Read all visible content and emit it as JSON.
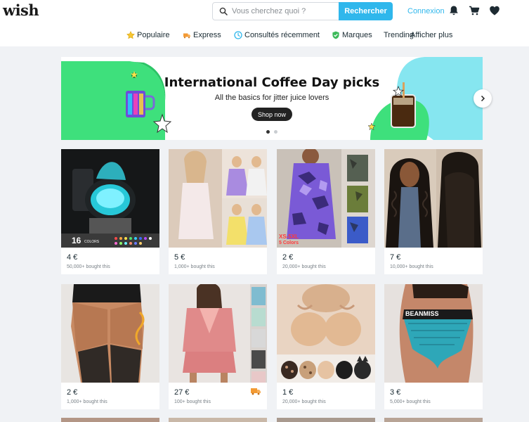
{
  "header": {
    "logo": "wish",
    "search_placeholder": "Vous cherchez quoi ?",
    "search_button": "Rechercher",
    "login": "Connexion",
    "icons": [
      "bell-icon",
      "cart-icon",
      "heart-icon"
    ]
  },
  "nav": [
    {
      "label": "Populaire",
      "icon": "star-icon"
    },
    {
      "label": "Express",
      "icon": "express-icon"
    },
    {
      "label": "Consultés récemment",
      "icon": "clock-icon"
    },
    {
      "label": "Marques",
      "icon": "verified-icon"
    },
    {
      "label": "Trending",
      "icon": ""
    },
    {
      "label": "Afficher plus",
      "icon": ""
    }
  ],
  "banner": {
    "title": "International Coffee Day picks",
    "subtitle": "All the basics for jitter juice lovers",
    "button": "Shop now",
    "slides": 2,
    "active_slide": 1
  },
  "products": [
    {
      "price": "4 €",
      "bought": "50,000+ bought this",
      "image_text": "16",
      "image_subtext": "COLORS"
    },
    {
      "price": "5 €",
      "bought": "1,000+ bought this"
    },
    {
      "price": "2 €",
      "bought": "20,000+ bought this",
      "image_text": "XS-5XL",
      "image_subtext": "5 Colors"
    },
    {
      "price": "7 €",
      "bought": "10,000+ bought this"
    },
    {
      "price": "2 €",
      "bought": "1,000+ bought this"
    },
    {
      "price": "27 €",
      "bought": "100+ bought this",
      "badge": "express-truck-icon"
    },
    {
      "price": "1 €",
      "bought": "20,000+ bought this"
    },
    {
      "price": "3 €",
      "bought": "5,000+ bought this",
      "image_text": "BEANMISS"
    }
  ],
  "colors": {
    "accent": "#2fb7ec",
    "banner_green": "#3ee07c",
    "banner_cyan": "#86e6f0",
    "express_orange": "#f39a33"
  }
}
